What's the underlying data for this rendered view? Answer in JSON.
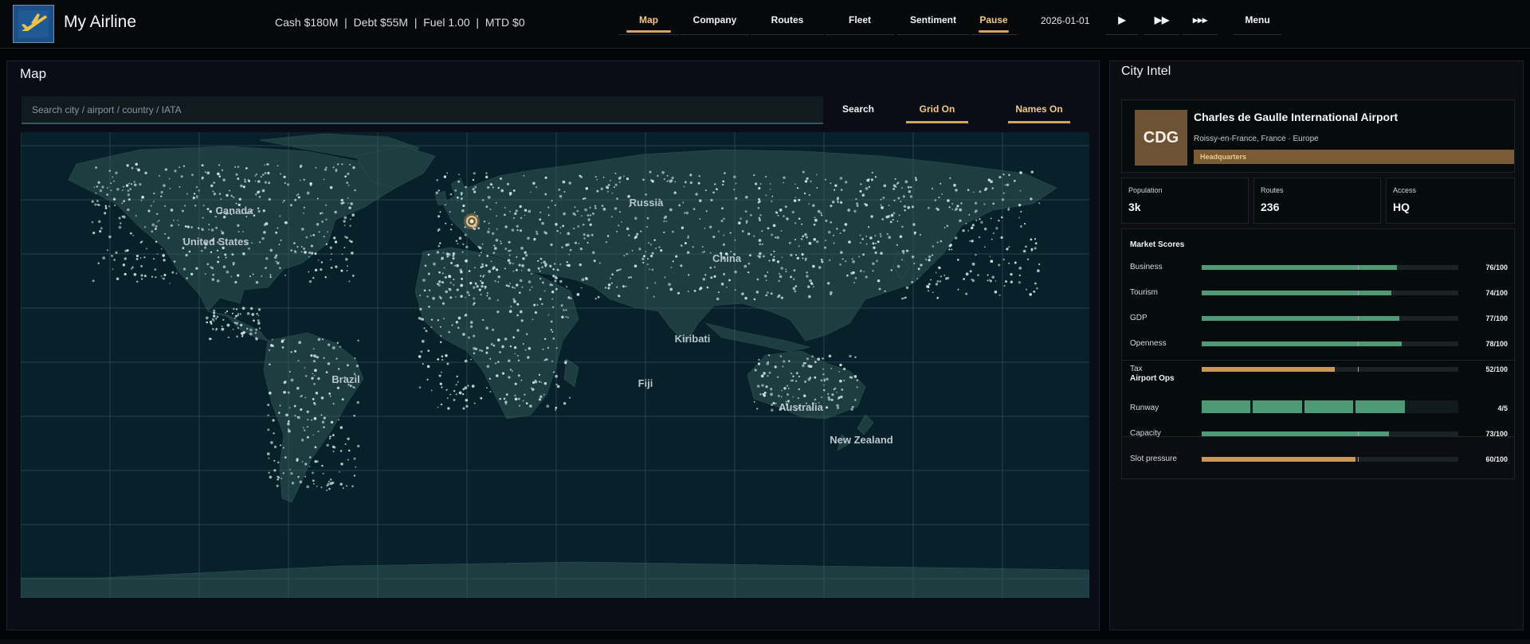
{
  "app": {
    "title": "My Airline"
  },
  "stats": {
    "text": "Cash $180M  |  Debt $55M  |  Fuel 1.00  |  MTD $0"
  },
  "nav": {
    "items": [
      "Map",
      "Company",
      "Routes",
      "Fleet",
      "Sentiment",
      "Pause"
    ],
    "date": "2026-01-01",
    "play_icon": "▶",
    "fast_icon": "▶▶",
    "fastest_icon": "▸▸▸",
    "menu": "Menu"
  },
  "map_panel": {
    "title": "Map",
    "search_placeholder": "Search city / airport / country / IATA",
    "search_button": "Search",
    "grid_toggle": "Grid On",
    "names_toggle": "Names On",
    "labels": [
      "Canada",
      "United States",
      "Russia",
      "China",
      "Brazil",
      "Kiribati",
      "Fiji",
      "Australia",
      "New Zealand"
    ],
    "selected_marker_icon": "selected-airport-marker"
  },
  "intel": {
    "title": "City Intel",
    "iata": "CDG",
    "airport_name": "Charles de Gaulle International Airport",
    "location": "Roissy-en-France, France · Europe",
    "badge": "Headquarters",
    "stats": [
      {
        "label": "Population",
        "value": "3k"
      },
      {
        "label": "Routes",
        "value": "236"
      },
      {
        "label": "Access",
        "value": "HQ"
      }
    ],
    "market_title": "Market Scores",
    "market": [
      {
        "label": "Business",
        "value_text": "76/100",
        "value": 76,
        "color": "#4f9a76"
      },
      {
        "label": "Tourism",
        "value_text": "74/100",
        "value": 74,
        "color": "#4f9a76"
      },
      {
        "label": "GDP",
        "value_text": "77/100",
        "value": 77,
        "color": "#4f9a76"
      },
      {
        "label": "Openness",
        "value_text": "78/100",
        "value": 78,
        "color": "#4f9a76"
      },
      {
        "label": "Tax",
        "value_text": "52/100",
        "value": 52,
        "color": "#c9975a"
      }
    ],
    "ops_title": "Airport Ops",
    "runway": {
      "label": "Runway",
      "value_text": "4/5",
      "value": 4,
      "max": 5,
      "color": "#4f9a76"
    },
    "ops": [
      {
        "label": "Capacity",
        "value_text": "73/100",
        "value": 73,
        "color": "#4f9a76"
      },
      {
        "label": "Slot pressure",
        "value_text": "60/100",
        "value": 60,
        "color": "#c9975a"
      }
    ]
  },
  "colors": {
    "accent": "#d9a25b",
    "positive": "#4f9a76",
    "warning": "#c9975a",
    "land": "#1e3d40",
    "ocean": "#082029"
  }
}
